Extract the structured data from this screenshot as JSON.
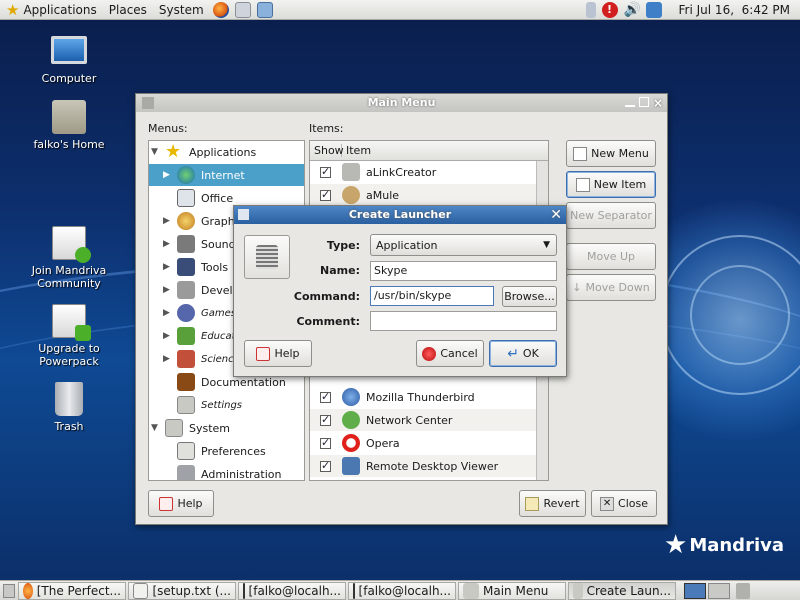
{
  "top_panel": {
    "applications": "Applications",
    "places": "Places",
    "system": "System",
    "clock": "Fri Jul 16,  6:42 PM"
  },
  "desktop": {
    "icons": [
      {
        "label": "Computer",
        "icon": "computer-icon"
      },
      {
        "label": "falko's Home",
        "icon": "home-folder-icon"
      },
      {
        "label": "Join Mandriva Community",
        "icon": "community-icon"
      },
      {
        "label": "Upgrade to Powerpack",
        "icon": "upgrade-icon"
      },
      {
        "label": "Trash",
        "icon": "trash-icon"
      }
    ],
    "brand": "Mandriva"
  },
  "main_menu": {
    "title": "Main Menu",
    "menus_label": "Menus:",
    "items_label": "Items:",
    "tree": [
      {
        "label": "Applications",
        "icon": "star-icon"
      },
      {
        "label": "Internet",
        "icon": "globe-icon"
      },
      {
        "label": "Office",
        "icon": "office-icon"
      },
      {
        "label": "Graphics",
        "icon": "graphics-icon"
      },
      {
        "label": "Sound",
        "icon": "sound-icon"
      },
      {
        "label": "Tools",
        "icon": "tools-icon"
      },
      {
        "label": "Development",
        "icon": "development-icon"
      },
      {
        "label": "Games",
        "icon": "games-icon"
      },
      {
        "label": "Education",
        "icon": "education-icon"
      },
      {
        "label": "Sciences",
        "icon": "sciences-icon"
      },
      {
        "label": "Documentation",
        "icon": "documentation-icon"
      },
      {
        "label": "Settings",
        "icon": "settings-icon"
      },
      {
        "label": "System",
        "icon": "system-icon"
      },
      {
        "label": "Preferences",
        "icon": "preferences-icon"
      },
      {
        "label": "Administration",
        "icon": "administration-icon"
      }
    ],
    "items_columns": {
      "show": "Show",
      "item": "Item"
    },
    "items": [
      {
        "label": "aLinkCreator"
      },
      {
        "label": "aMule"
      },
      {
        "label": "Mozilla Thunderbird"
      },
      {
        "label": "Network Center"
      },
      {
        "label": "Opera"
      },
      {
        "label": "Remote Desktop Viewer"
      }
    ],
    "buttons": {
      "new_menu": "New Menu",
      "new_item": "New Item",
      "new_separator": "New Separator",
      "move_up": "Move Up",
      "move_down": "Move Down",
      "help": "Help",
      "revert": "Revert",
      "close": "Close"
    }
  },
  "create_launcher": {
    "title": "Create Launcher",
    "type_label": "Type:",
    "type_value": "Application",
    "name_label": "Name:",
    "name_value": "Skype",
    "command_label": "Command:",
    "command_value": "/usr/bin/skype",
    "comment_label": "Comment:",
    "comment_value": "",
    "browse": "Browse...",
    "help": "Help",
    "cancel": "Cancel",
    "ok": "OK"
  },
  "taskbar": {
    "tasks": [
      {
        "label": "[The Perfect..."
      },
      {
        "label": "[setup.txt (..."
      },
      {
        "label": "[falko@localh..."
      },
      {
        "label": "[falko@localh..."
      },
      {
        "label": "Main Menu"
      },
      {
        "label": "Create Laun..."
      }
    ]
  }
}
